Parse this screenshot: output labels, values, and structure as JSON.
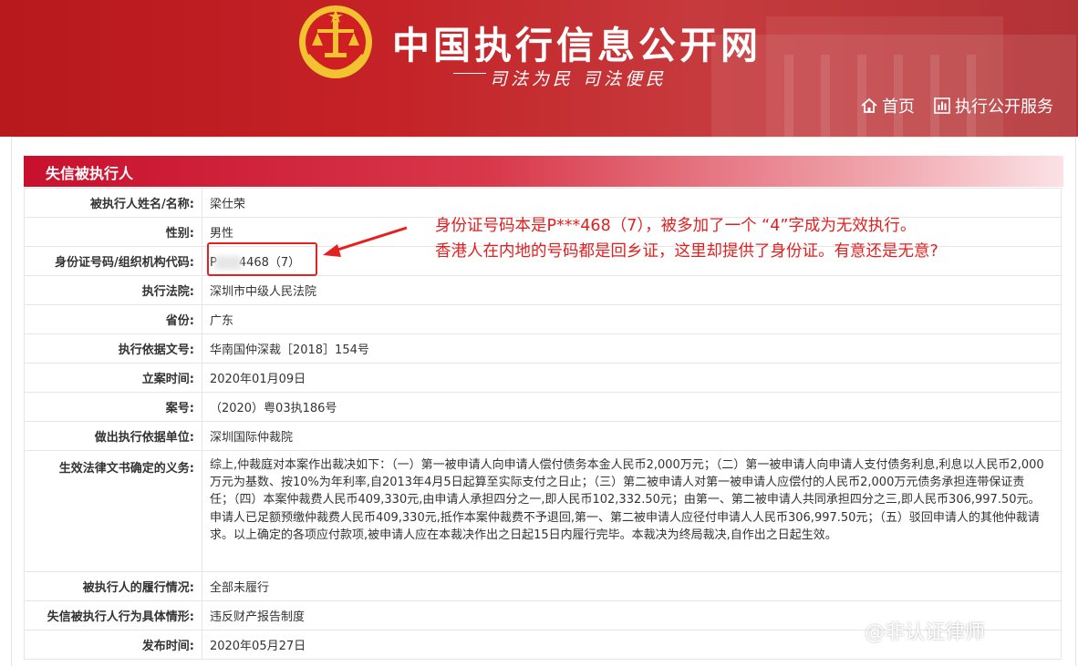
{
  "header": {
    "site_title": "中国执行信息公开网",
    "slogan": "司法为民  司法便民",
    "nav": {
      "home_label": "首页",
      "service_label": "执行公开服务"
    },
    "brand_color": "#c0191d"
  },
  "section": {
    "title": "失信被执行人"
  },
  "record": {
    "name_label": "被执行人姓名/名称:",
    "name_value": "梁仕荣",
    "gender_label": "性别:",
    "gender_value": "男性",
    "id_label": "身份证号码/组织机构代码:",
    "id_prefix": "P",
    "id_suffix": "4468（7）",
    "court_label": "执行法院:",
    "court_value": "深圳市中级人民法院",
    "province_label": "省份:",
    "province_value": "广东",
    "basis_doc_label": "执行依据文号:",
    "basis_doc_value": "华南国仲深裁［2018］154号",
    "filing_date_label": "立案时间:",
    "filing_date_value": "2020年01月09日",
    "case_no_label": "案号:",
    "case_no_value": "（2020）粤03执186号",
    "basis_unit_label": "做出执行依据单位:",
    "basis_unit_value": "深圳国际仲裁院",
    "obligation_label": "生效法律文书确定的义务:",
    "obligation_value": "综上,仲裁庭对本案作出裁决如下：（一）第一被申请人向申请人偿付债务本金人民币2,000万元；（二）第一被申请人向申请人支付债务利息,利息以人民币2,000万元为基数、按10%为年利率,自2013年4月5日起算至实际支付之日止；（三）第二被申请人对第一被申请人应偿付的人民币2,000万元债务承担连带保证责任；（四）本案仲裁费人民币409,330元,由申请人承担四分之一,即人民币102,332.50元；由第一、第二被申请人共同承担四分之三,即人民币306,997.50元。申请人已足额预缴仲裁费人民币409,330元,抵作本案仲裁费不予退回,第一、第二被申请人应径付申请人人民币306,997.50元；（五）驳回申请人的其他仲裁请求。以上确定的各项应付款项,被申请人应在本裁决作出之日起15日内履行完毕。本裁决为终局裁决,自作出之日起生效。",
    "performance_label": "被执行人的履行情况:",
    "performance_value": "全部未履行",
    "situation_label": "失信被执行人行为具体情形:",
    "situation_value": "违反财产报告制度",
    "publish_label": "发布时间:",
    "publish_value": "2020年05月27日"
  },
  "annotation": {
    "line1": "身份证号码本是P***468（7），被多加了一个 “4”字成为无效执行。",
    "line2": "香港人在内地的号码都是回乡证，这里却提供了身份证。有意还是无意?",
    "color": "#e21f1f"
  },
  "watermark": {
    "text": "@非认证律师"
  }
}
